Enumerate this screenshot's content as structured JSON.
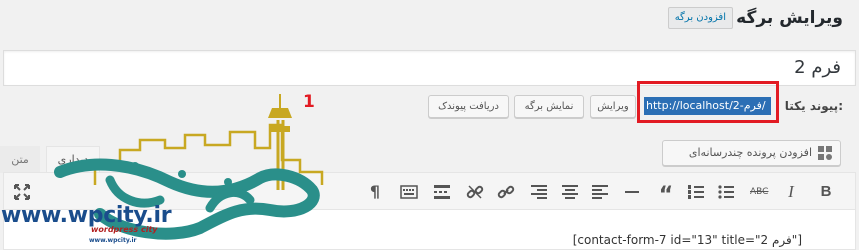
{
  "header": {
    "title": "ویرایش برگه",
    "add_page_button": "افزودن برگه"
  },
  "title_field": {
    "value": "فرم 2"
  },
  "permalink": {
    "label": "پیوند یکتا:",
    "url": "http://localhost/فرم-2/",
    "edit_button": "ویرایش",
    "view_button": "نمایش برگه",
    "get_shortlink_button": "دریافت پیوندک"
  },
  "annotation": {
    "number": "1",
    "color": "#e21b23"
  },
  "media": {
    "add_media_button": "افزودن پرونده چندرسانه‌ای"
  },
  "editor": {
    "tabs": [
      {
        "label": "دیداری"
      },
      {
        "label": "متن"
      }
    ],
    "toolbar_icons": [
      "bold-icon",
      "italic-icon",
      "strikethrough-icon",
      "bullet-list-icon",
      "numbered-list-icon",
      "blockquote-icon",
      "horizontal-rule-icon",
      "align-left-icon",
      "align-center-icon",
      "align-right-icon",
      "link-icon",
      "unlink-icon",
      "read-more-icon",
      "toolbar-toggle-icon",
      "paragraph-icon",
      "fullscreen-icon"
    ],
    "content": "[contact-form-7 id=\"13\" title=\"فرم 2\"]"
  },
  "watermark": {
    "url": "www.wpcity.ir",
    "brand": "wordpress city",
    "brand_url": "www.wpcity.ir"
  },
  "colors": {
    "accent": "#0073aa",
    "selection": "#2c6fb5",
    "logo_green": "#2a8f8a",
    "logo_gold": "#c8a822"
  }
}
